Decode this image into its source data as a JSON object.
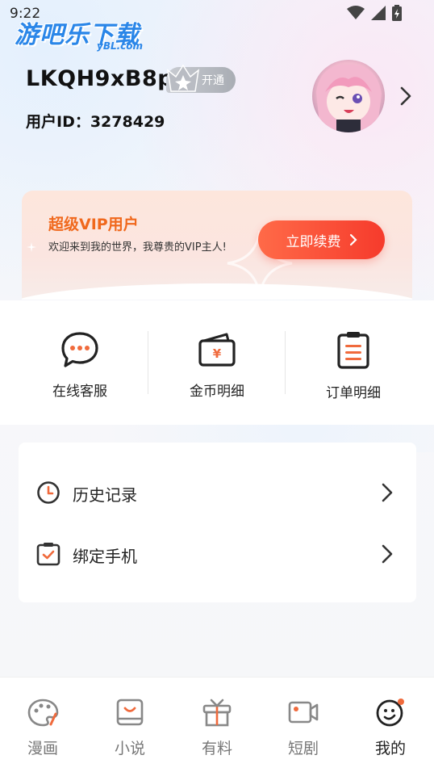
{
  "status_bar": {
    "time": "9:22"
  },
  "watermark": {
    "text": "游吧乐下载",
    "sub": "yBL.com"
  },
  "profile": {
    "username": "LKQH9xB8p",
    "vip_chip_label": "开通",
    "user_id": "用户ID：3278429"
  },
  "vip_banner": {
    "title": "超级VIP用户",
    "description": "欢迎来到我的世界，我尊贵的VIP主人!",
    "button_label": "立即续费"
  },
  "quick_actions": [
    {
      "label": "在线客服",
      "icon": "chat-bubble-icon"
    },
    {
      "label": "金币明细",
      "icon": "wallet-icon"
    },
    {
      "label": "订单明细",
      "icon": "clipboard-list-icon"
    }
  ],
  "menu": [
    {
      "label": "历史记录",
      "icon": "clock-icon"
    },
    {
      "label": "绑定手机",
      "icon": "clipboard-check-icon"
    }
  ],
  "bottom_nav": [
    {
      "label": "漫画",
      "icon": "palette-icon"
    },
    {
      "label": "小说",
      "icon": "book-icon"
    },
    {
      "label": "有料",
      "icon": "gift-icon"
    },
    {
      "label": "短剧",
      "icon": "video-icon"
    },
    {
      "label": "我的",
      "icon": "profile-face-icon",
      "active": true
    }
  ],
  "colors": {
    "accent": "#f0681c",
    "button": "#f63b2c",
    "icon_orange": "#f06a3c"
  }
}
